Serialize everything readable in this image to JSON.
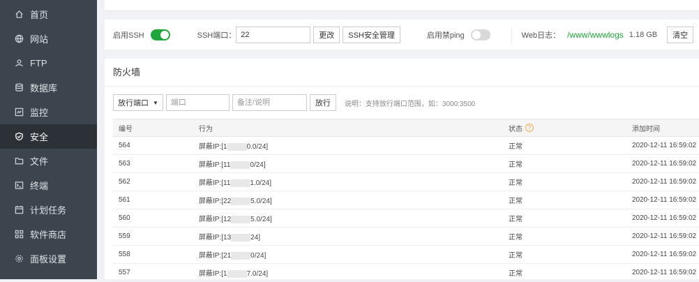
{
  "sidebar": {
    "items": [
      {
        "label": "首页",
        "icon": "home-icon"
      },
      {
        "label": "网站",
        "icon": "globe-icon"
      },
      {
        "label": "FTP",
        "icon": "user-icon"
      },
      {
        "label": "数据库",
        "icon": "database-icon"
      },
      {
        "label": "监控",
        "icon": "monitor-icon"
      },
      {
        "label": "安全",
        "icon": "shield-icon",
        "active": true
      },
      {
        "label": "文件",
        "icon": "folder-icon"
      },
      {
        "label": "终端",
        "icon": "terminal-icon"
      },
      {
        "label": "计划任务",
        "icon": "calendar-icon"
      },
      {
        "label": "软件商店",
        "icon": "apps-icon"
      },
      {
        "label": "面板设置",
        "icon": "gear-icon"
      }
    ]
  },
  "ssh": {
    "enable_label": "启用SSH",
    "enabled": true,
    "port_label": "SSH端口：",
    "port_value": "22",
    "change_button": "更改",
    "security_button": "SSH安全管理",
    "ping_label": "启用禁ping",
    "ping_enabled": false,
    "weblog_label": "Web日志：",
    "weblog_path": "/www/wwwlogs",
    "weblog_size": "1.18 GB",
    "clear_button": "清空"
  },
  "firewall": {
    "title": "防火墙",
    "select_value": "放行端口",
    "port_placeholder": "端口",
    "note_placeholder": "备注/说明",
    "allow_button": "放行",
    "hint": "说明：支持放行端口范围，如：3000:3500",
    "columns": {
      "id": "编号",
      "action": "行为",
      "status": "状态",
      "time": "添加时间"
    },
    "rows": [
      {
        "id": "564",
        "action_prefix": "屏蔽IP:[1",
        "action_suffix": "0.0/24]",
        "status": "正常",
        "time": "2020-12-11 16:59:02"
      },
      {
        "id": "563",
        "action_prefix": "屏蔽IP:[11",
        "action_suffix": "0/24]",
        "status": "正常",
        "time": "2020-12-11 16:59:02"
      },
      {
        "id": "562",
        "action_prefix": "屏蔽IP:[11",
        "action_suffix": "1.0/24]",
        "status": "正常",
        "time": "2020-12-11 16:59:02"
      },
      {
        "id": "561",
        "action_prefix": "屏蔽IP:[22",
        "action_suffix": "5.0/24]",
        "status": "正常",
        "time": "2020-12-11 16:59:02"
      },
      {
        "id": "560",
        "action_prefix": "屏蔽IP:[12",
        "action_suffix": "5.0/24]",
        "status": "正常",
        "time": "2020-12-11 16:59:02"
      },
      {
        "id": "559",
        "action_prefix": "屏蔽IP:[13",
        "action_suffix": "24]",
        "status": "正常",
        "time": "2020-12-11 16:59:02"
      },
      {
        "id": "558",
        "action_prefix": "屏蔽IP:[21",
        "action_suffix": "0/24]",
        "status": "正常",
        "time": "2020-12-11 16:59:02"
      },
      {
        "id": "557",
        "action_prefix": "屏蔽IP:[1",
        "action_suffix": "7.0/24]",
        "status": "正常",
        "time": "2020-12-11 16:59:02"
      }
    ]
  },
  "colors": {
    "accent": "#20a53a",
    "sidebar_bg": "#3c444d",
    "sidebar_active": "#2c3138",
    "help": "#f0ad4e"
  }
}
